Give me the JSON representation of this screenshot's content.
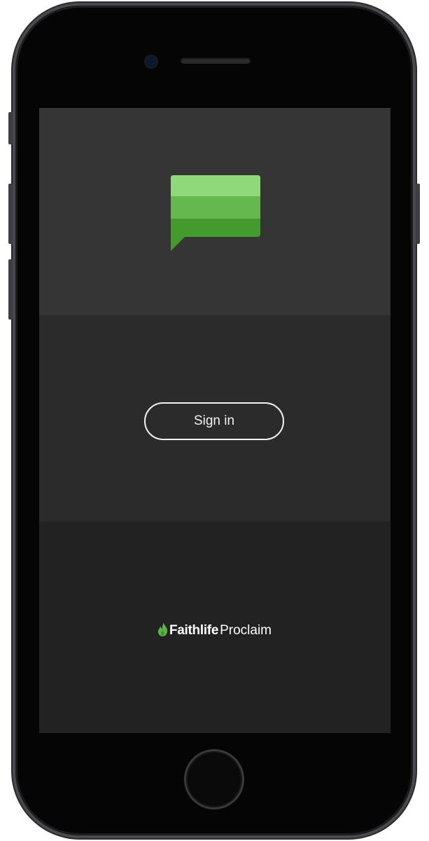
{
  "app": {
    "icon": "chat-bubble-icon",
    "colors": {
      "icon_light": "#8fd97a",
      "icon_mid": "#65b84e",
      "icon_dark": "#449a2c",
      "screen_top": "#353535",
      "screen_mid": "#2b2b2b",
      "screen_bottom": "#222222"
    }
  },
  "login": {
    "sign_in_label": "Sign in"
  },
  "footer": {
    "brand_bold": "Faithlife",
    "brand_regular": "Proclaim",
    "brand_icon": "flame-icon",
    "brand_color": "#5cb544"
  }
}
